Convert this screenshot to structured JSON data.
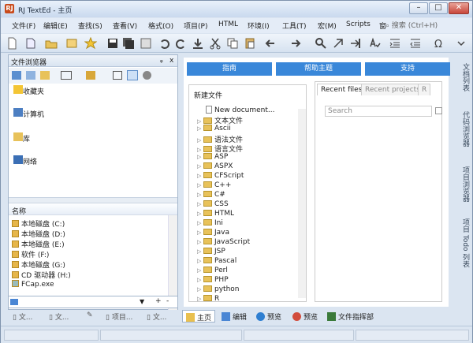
{
  "window": {
    "title": "RJ TextEd - 主页",
    "app_icon": "RJ"
  },
  "menu": [
    "文件(F)",
    "编辑(E)",
    "查找(S)",
    "查看(V)",
    "格式(O)",
    "项目(P)",
    "HTML",
    "环境(I)",
    "工具(T)",
    "宏(M)",
    "Scripts",
    "窗"
  ],
  "search": {
    "placeholder": "搜索 (Ctrl+H)"
  },
  "file_browser": {
    "title": "文件浏览器",
    "pin": "ᵩ",
    "close": "x",
    "places": [
      "收藏夹",
      "计算机",
      "库",
      "网络"
    ],
    "column": "名称",
    "drives": [
      "本地磁盘 (C:)",
      "本地磁盘 (D:)",
      "本地磁盘 (E:)",
      "软件 (F:)",
      "本地磁盘 (G:)",
      "CD 驱动器 (H:)",
      "FCap.exe"
    ],
    "filter_plus": "+",
    "filter_minus": "-"
  },
  "left_tabs": [
    "文...",
    "文...",
    "项目...",
    "文..."
  ],
  "top_buttons": [
    "指南",
    "帮助主题",
    "支持"
  ],
  "new_doc": {
    "title": "新建文件",
    "first": "New document...",
    "items": [
      "文本文件",
      "Ascii",
      "语法文件",
      "语言文件",
      "ASP",
      "ASPX",
      "CFScript",
      "C++",
      "C#",
      "CSS",
      "HTML",
      "Ini",
      "Java",
      "JavaScript",
      "JSP",
      "Pascal",
      "Perl",
      "PHP",
      "python",
      "R"
    ]
  },
  "recent": {
    "tabs": [
      "Recent files",
      "Recent projects",
      "R"
    ],
    "search_placeholder": "Search"
  },
  "side_tabs": [
    "文档列表",
    "代码浏览器",
    "项目浏览器",
    "项目 Todo 列表"
  ],
  "doc_tabs": [
    "主页",
    "编辑",
    "预览",
    "预览",
    "文件指挥部"
  ],
  "colors": {
    "accent_button": "#3987d9",
    "title_bar": "#c9d9ee",
    "folder": "#e8c25a"
  }
}
